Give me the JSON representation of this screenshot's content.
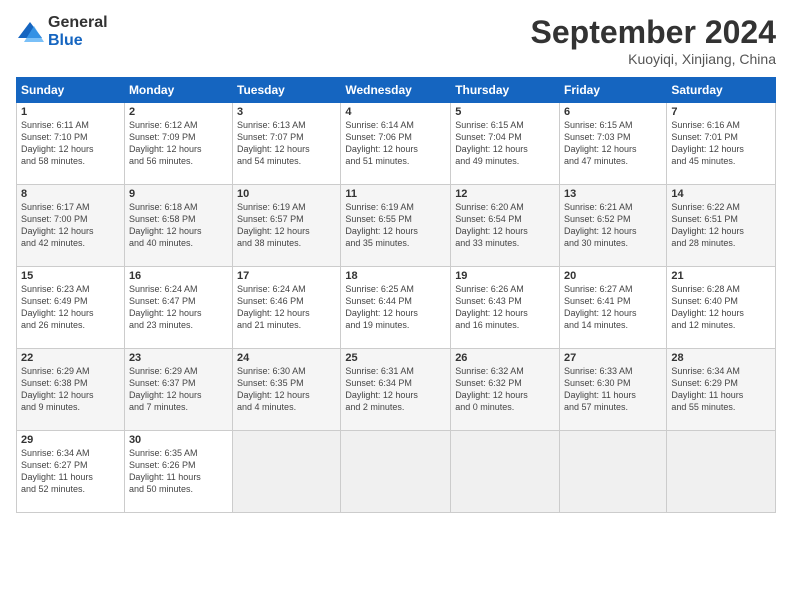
{
  "logo": {
    "general": "General",
    "blue": "Blue"
  },
  "header": {
    "title": "September 2024",
    "subtitle": "Kuoyiqi, Xinjiang, China"
  },
  "weekdays": [
    "Sunday",
    "Monday",
    "Tuesday",
    "Wednesday",
    "Thursday",
    "Friday",
    "Saturday"
  ],
  "weeks": [
    [
      {
        "day": "1",
        "info": "Sunrise: 6:11 AM\nSunset: 7:10 PM\nDaylight: 12 hours\nand 58 minutes."
      },
      {
        "day": "2",
        "info": "Sunrise: 6:12 AM\nSunset: 7:09 PM\nDaylight: 12 hours\nand 56 minutes."
      },
      {
        "day": "3",
        "info": "Sunrise: 6:13 AM\nSunset: 7:07 PM\nDaylight: 12 hours\nand 54 minutes."
      },
      {
        "day": "4",
        "info": "Sunrise: 6:14 AM\nSunset: 7:06 PM\nDaylight: 12 hours\nand 51 minutes."
      },
      {
        "day": "5",
        "info": "Sunrise: 6:15 AM\nSunset: 7:04 PM\nDaylight: 12 hours\nand 49 minutes."
      },
      {
        "day": "6",
        "info": "Sunrise: 6:15 AM\nSunset: 7:03 PM\nDaylight: 12 hours\nand 47 minutes."
      },
      {
        "day": "7",
        "info": "Sunrise: 6:16 AM\nSunset: 7:01 PM\nDaylight: 12 hours\nand 45 minutes."
      }
    ],
    [
      {
        "day": "8",
        "info": "Sunrise: 6:17 AM\nSunset: 7:00 PM\nDaylight: 12 hours\nand 42 minutes."
      },
      {
        "day": "9",
        "info": "Sunrise: 6:18 AM\nSunset: 6:58 PM\nDaylight: 12 hours\nand 40 minutes."
      },
      {
        "day": "10",
        "info": "Sunrise: 6:19 AM\nSunset: 6:57 PM\nDaylight: 12 hours\nand 38 minutes."
      },
      {
        "day": "11",
        "info": "Sunrise: 6:19 AM\nSunset: 6:55 PM\nDaylight: 12 hours\nand 35 minutes."
      },
      {
        "day": "12",
        "info": "Sunrise: 6:20 AM\nSunset: 6:54 PM\nDaylight: 12 hours\nand 33 minutes."
      },
      {
        "day": "13",
        "info": "Sunrise: 6:21 AM\nSunset: 6:52 PM\nDaylight: 12 hours\nand 30 minutes."
      },
      {
        "day": "14",
        "info": "Sunrise: 6:22 AM\nSunset: 6:51 PM\nDaylight: 12 hours\nand 28 minutes."
      }
    ],
    [
      {
        "day": "15",
        "info": "Sunrise: 6:23 AM\nSunset: 6:49 PM\nDaylight: 12 hours\nand 26 minutes."
      },
      {
        "day": "16",
        "info": "Sunrise: 6:24 AM\nSunset: 6:47 PM\nDaylight: 12 hours\nand 23 minutes."
      },
      {
        "day": "17",
        "info": "Sunrise: 6:24 AM\nSunset: 6:46 PM\nDaylight: 12 hours\nand 21 minutes."
      },
      {
        "day": "18",
        "info": "Sunrise: 6:25 AM\nSunset: 6:44 PM\nDaylight: 12 hours\nand 19 minutes."
      },
      {
        "day": "19",
        "info": "Sunrise: 6:26 AM\nSunset: 6:43 PM\nDaylight: 12 hours\nand 16 minutes."
      },
      {
        "day": "20",
        "info": "Sunrise: 6:27 AM\nSunset: 6:41 PM\nDaylight: 12 hours\nand 14 minutes."
      },
      {
        "day": "21",
        "info": "Sunrise: 6:28 AM\nSunset: 6:40 PM\nDaylight: 12 hours\nand 12 minutes."
      }
    ],
    [
      {
        "day": "22",
        "info": "Sunrise: 6:29 AM\nSunset: 6:38 PM\nDaylight: 12 hours\nand 9 minutes."
      },
      {
        "day": "23",
        "info": "Sunrise: 6:29 AM\nSunset: 6:37 PM\nDaylight: 12 hours\nand 7 minutes."
      },
      {
        "day": "24",
        "info": "Sunrise: 6:30 AM\nSunset: 6:35 PM\nDaylight: 12 hours\nand 4 minutes."
      },
      {
        "day": "25",
        "info": "Sunrise: 6:31 AM\nSunset: 6:34 PM\nDaylight: 12 hours\nand 2 minutes."
      },
      {
        "day": "26",
        "info": "Sunrise: 6:32 AM\nSunset: 6:32 PM\nDaylight: 12 hours\nand 0 minutes."
      },
      {
        "day": "27",
        "info": "Sunrise: 6:33 AM\nSunset: 6:30 PM\nDaylight: 11 hours\nand 57 minutes."
      },
      {
        "day": "28",
        "info": "Sunrise: 6:34 AM\nSunset: 6:29 PM\nDaylight: 11 hours\nand 55 minutes."
      }
    ],
    [
      {
        "day": "29",
        "info": "Sunrise: 6:34 AM\nSunset: 6:27 PM\nDaylight: 11 hours\nand 52 minutes."
      },
      {
        "day": "30",
        "info": "Sunrise: 6:35 AM\nSunset: 6:26 PM\nDaylight: 11 hours\nand 50 minutes."
      },
      {
        "day": "",
        "info": ""
      },
      {
        "day": "",
        "info": ""
      },
      {
        "day": "",
        "info": ""
      },
      {
        "day": "",
        "info": ""
      },
      {
        "day": "",
        "info": ""
      }
    ]
  ]
}
